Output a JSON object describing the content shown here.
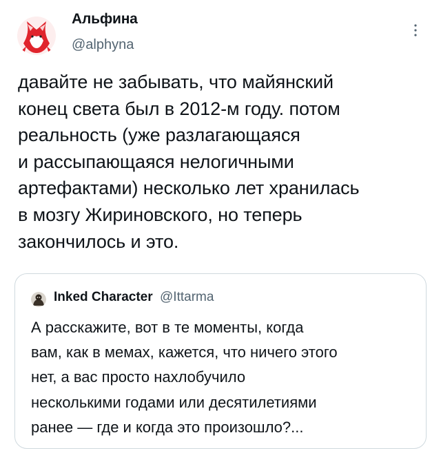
{
  "tweet": {
    "author_name": "Альфина",
    "author_handle": "@alphyna",
    "text_lines": [
      "давайте не забывать, что майянский",
      "конец света был в 2012-м году. потом",
      "реальность (уже разлагающаяся",
      "и рассыпающаяся нелогичными",
      "артефактами) несколько лет хранилась",
      "в мозгу Жириновского, но теперь",
      "закончилось и это."
    ],
    "avatar_icon": "fox-avatar-icon",
    "more_icon": "vertical-ellipsis-icon"
  },
  "quoted": {
    "author_name": "Inked Character",
    "author_handle": "@Ittarma",
    "avatar_icon": "character-avatar-icon",
    "text_lines": [
      "А расскажите, вот в те моменты, когда",
      "вам, как в мемах, кажется, что ничего этого",
      "нет, а вас просто нахлобучило",
      "несколькими годами или десятилетиями",
      "ранее — где и когда это произошло?..."
    ]
  },
  "colors": {
    "text": "#0f1419",
    "secondary": "#536471",
    "border": "#cfd9de",
    "avatar_accent": "#e0242c"
  }
}
